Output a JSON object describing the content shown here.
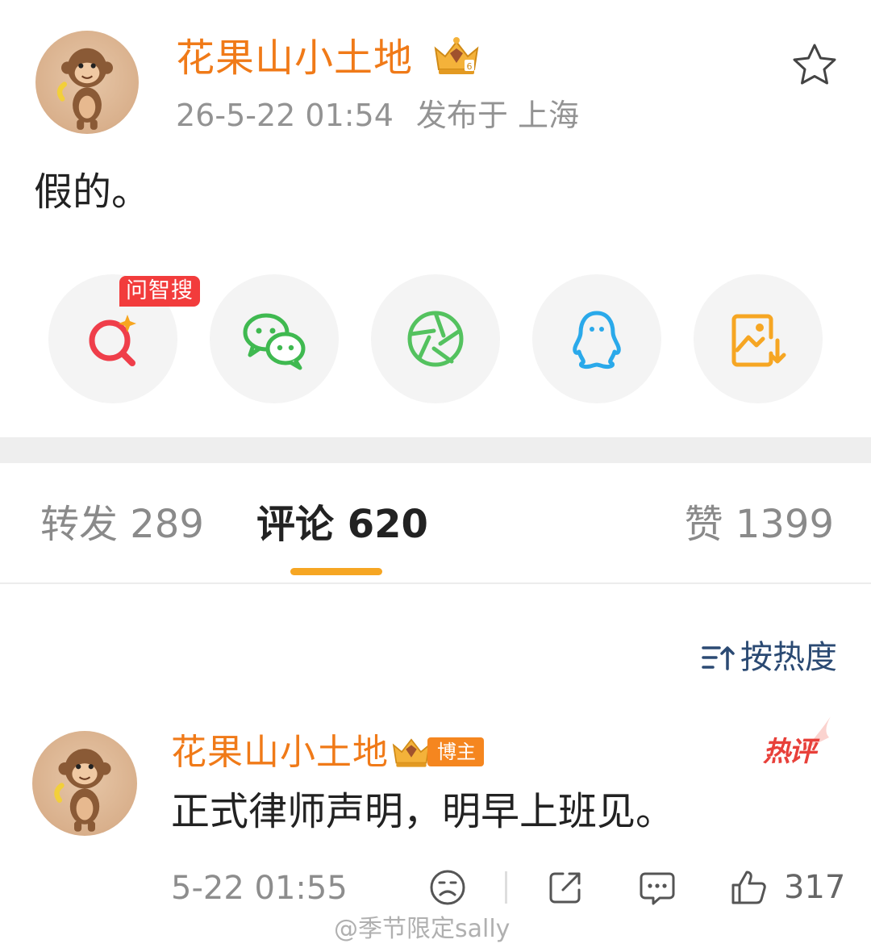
{
  "post": {
    "author": "花果山小土地",
    "time": "26-5-22 01:54",
    "location": "发布于 上海",
    "body": "假的。",
    "badge_icon": "crown-vip-icon",
    "favorite_icon": "star-icon"
  },
  "share": {
    "ai_tag": "问智搜",
    "items": [
      {
        "name": "ai-search",
        "icon": "ai-search-icon"
      },
      {
        "name": "wechat",
        "icon": "wechat-icon"
      },
      {
        "name": "moments",
        "icon": "moments-icon"
      },
      {
        "name": "qq",
        "icon": "qq-icon"
      },
      {
        "name": "save-image",
        "icon": "save-image-icon"
      }
    ]
  },
  "tabs": {
    "repost": "转发 289",
    "comments": "评论 620",
    "likes": "赞 1399"
  },
  "sort": {
    "label": "按热度",
    "icon": "sort-icon"
  },
  "comment": {
    "author": "花果山小土地",
    "badge": "博主",
    "hot_tag": "热评",
    "text": "正式律师声明，明早上班见。",
    "time": "5-22 01:55",
    "like_count": "317",
    "icons": [
      "sad-face-icon",
      "share-icon",
      "comment-icon",
      "thumbs-up-icon"
    ]
  },
  "watermark": "@季节限定sally",
  "colors": {
    "author": "#f07a18",
    "tab_accent": "#f6a623",
    "hot": "#e8403a",
    "sort_text": "#2b4a73"
  }
}
